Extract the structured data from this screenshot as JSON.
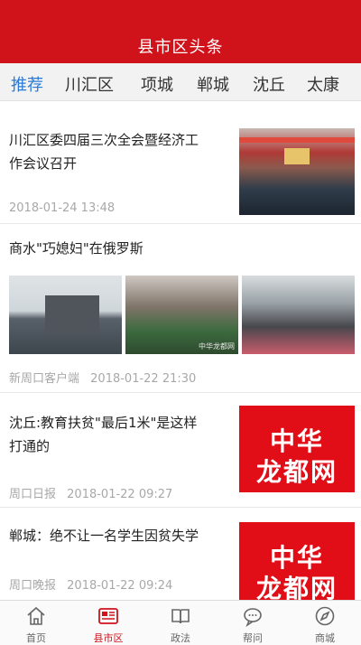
{
  "header": {
    "title": "县市区头条"
  },
  "tabs": [
    {
      "label": "推荐",
      "active": true
    },
    {
      "label": "川汇区"
    },
    {
      "label": "项城"
    },
    {
      "label": "郸城"
    },
    {
      "label": "沈丘"
    },
    {
      "label": "太康"
    }
  ],
  "news": [
    {
      "title": "川汇区委四届三次全会暨经济工作会议召开",
      "title_line1": "川汇区委四届三次全会暨经济工",
      "title_line2": "作会议召开",
      "source": "",
      "time": "2018-01-24 13:48"
    },
    {
      "title": "商水\"巧媳妇\"在俄罗斯",
      "source": "新周口客户端",
      "time": "2018-01-22 21:30",
      "photo_caption": "中华龙都网"
    },
    {
      "title_line1": "沈丘:教育扶贫\"最后1米\"是这样",
      "title_line2": "打通的",
      "source": "周口日报",
      "time": "2018-01-22 09:27"
    },
    {
      "title": "郸城：绝不让一名学生因贫失学",
      "source": "周口晚报",
      "time": "2018-01-22 09:24"
    }
  ],
  "logo": {
    "line1": "中华",
    "line2": "龙都网",
    "color": "#e10d17"
  },
  "tabbar": [
    {
      "label": "首页",
      "icon": "home-icon"
    },
    {
      "label": "县市区",
      "icon": "newspaper-icon",
      "active": true
    },
    {
      "label": "政法",
      "icon": "book-icon"
    },
    {
      "label": "帮问",
      "icon": "chat-bubble-icon"
    },
    {
      "label": "商城",
      "icon": "compass-icon"
    }
  ],
  "colors": {
    "brand": "#d0121b",
    "active_tab": "#2b7bd6",
    "meta_text": "#a8a8a8"
  }
}
